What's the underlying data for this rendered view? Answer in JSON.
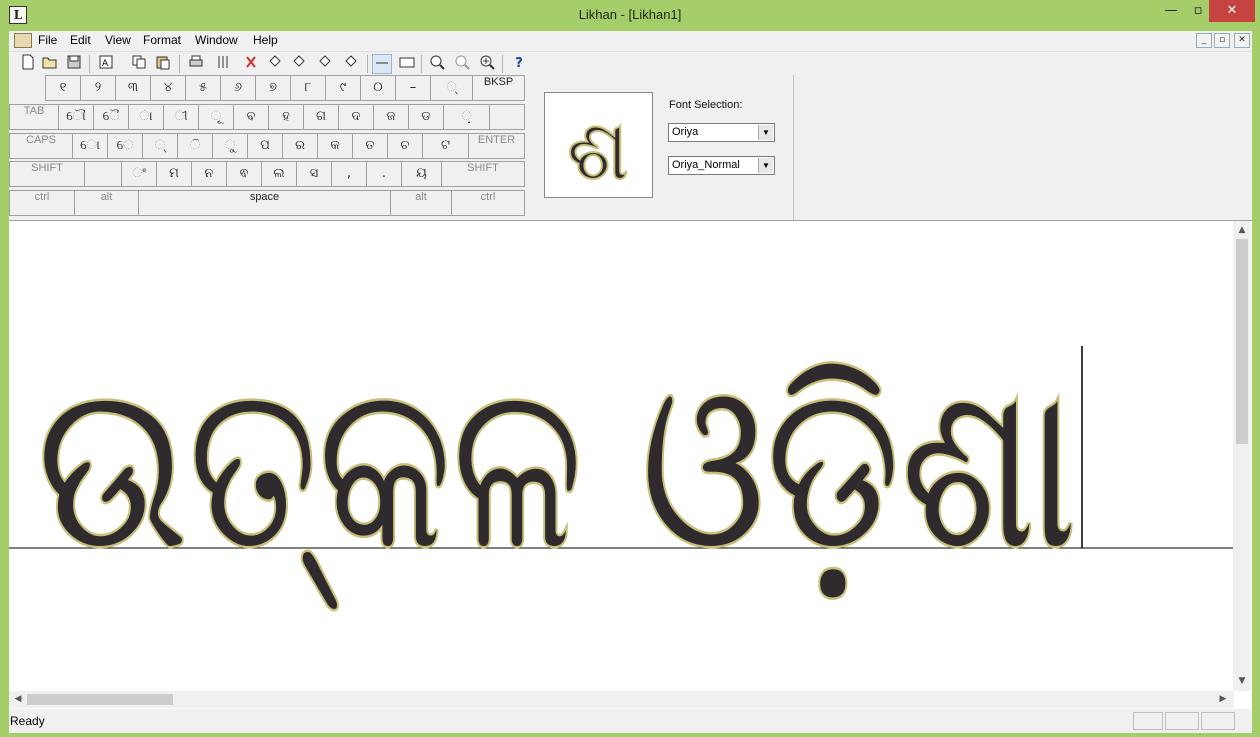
{
  "window": {
    "title": "Likhan - [Likhan1]",
    "app_icon_glyph": "L",
    "controls": {
      "minimize": "—",
      "maximize": "▫",
      "close": "✕"
    }
  },
  "menubar": {
    "items": [
      "File",
      "Edit",
      "View",
      "Format",
      "Window",
      "Help"
    ],
    "mdi_controls": [
      "_",
      "▫",
      "✕"
    ]
  },
  "toolbar": {
    "icons": [
      "new-file-icon",
      "open-folder-icon",
      "save-icon",
      "font-icon",
      "copy-icon",
      "paste-icon",
      "print-icon",
      "columns-icon",
      "clear-format-icon",
      "paint-bucket-icon",
      "paint-bucket-icon",
      "paint-bucket-icon",
      "paint-bucket-icon",
      "line-icon",
      "keyboard-icon",
      "zoom-out-icon",
      "zoom-icon",
      "zoom-in-icon",
      "help-icon"
    ],
    "help_label": "?"
  },
  "keyboard": {
    "row1": [
      "୧",
      "୨",
      "୩",
      "୪",
      "୫",
      "୬",
      "୭",
      "୮",
      "୯",
      "୦",
      "–",
      "୍",
      "BKSP"
    ],
    "row2": [
      "TAB",
      "ୌ",
      "ୈ",
      "ା",
      "ୀ",
      "ୂ",
      "ବ",
      "ହ",
      "ଗ",
      "ଦ",
      "ଜ",
      "ଡ",
      "଼"
    ],
    "row3": [
      "CAPS",
      "ୋ",
      "େ",
      "୍",
      "ି",
      "ୁ",
      "ପ",
      "ର",
      "କ",
      "ତ",
      "ଚ",
      "ଟ",
      "ENTER"
    ],
    "row4": [
      "SHIFT",
      "",
      "ଂ",
      "ମ",
      "ନ",
      "ଵ",
      "ଲ",
      "ସ",
      ",",
      ".",
      "ୟ",
      "SHIFT"
    ],
    "row5": [
      "ctrl",
      "alt",
      "space",
      "alt",
      "ctrl"
    ]
  },
  "font_selection": {
    "label": "Font Selection:",
    "font": "Oriya",
    "style": "Oriya_Normal",
    "preview_glyph": "ଶ"
  },
  "document": {
    "text": "ଉତ୍କଳ ଓଡ଼ିଶା",
    "glyph_colors": {
      "body": "#2e2a2e",
      "highlight": "#e8e6e8",
      "ornament": "#c8c07a",
      "ornament_edge": "#545020"
    }
  },
  "status": {
    "text": "Ready"
  }
}
